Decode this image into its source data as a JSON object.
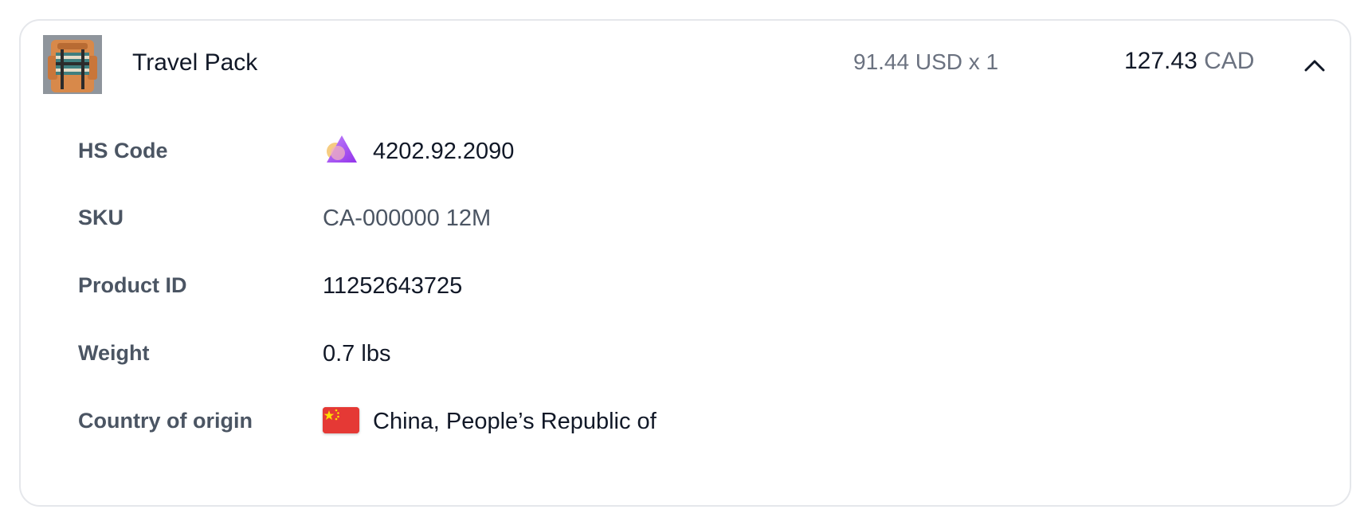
{
  "item": {
    "name": "Travel Pack",
    "unit_price": "91.44 USD x 1",
    "total_amount": "127.43",
    "total_currency": "CAD"
  },
  "details": {
    "hs_code": {
      "label": "HS Code",
      "value": "4202.92.2090",
      "icon": "hs-code-logo-icon"
    },
    "sku": {
      "label": "SKU",
      "value": "CA-000000 12M"
    },
    "product_id": {
      "label": "Product ID",
      "value": "11252643725"
    },
    "weight": {
      "label": "Weight",
      "value": "0.7 lbs"
    },
    "country": {
      "label": "Country of origin",
      "value": "China, People’s Republic of",
      "icon": "china-flag-icon"
    }
  },
  "colors": {
    "label": "#4b5563",
    "value": "#111827",
    "muted": "#6b7280",
    "border": "#e5e7eb",
    "flag_red": "#e53935",
    "flag_star": "#ffde00"
  },
  "icons": {
    "thumbnail": "backpack-thumbnail",
    "collapse": "chevron-up-icon"
  }
}
